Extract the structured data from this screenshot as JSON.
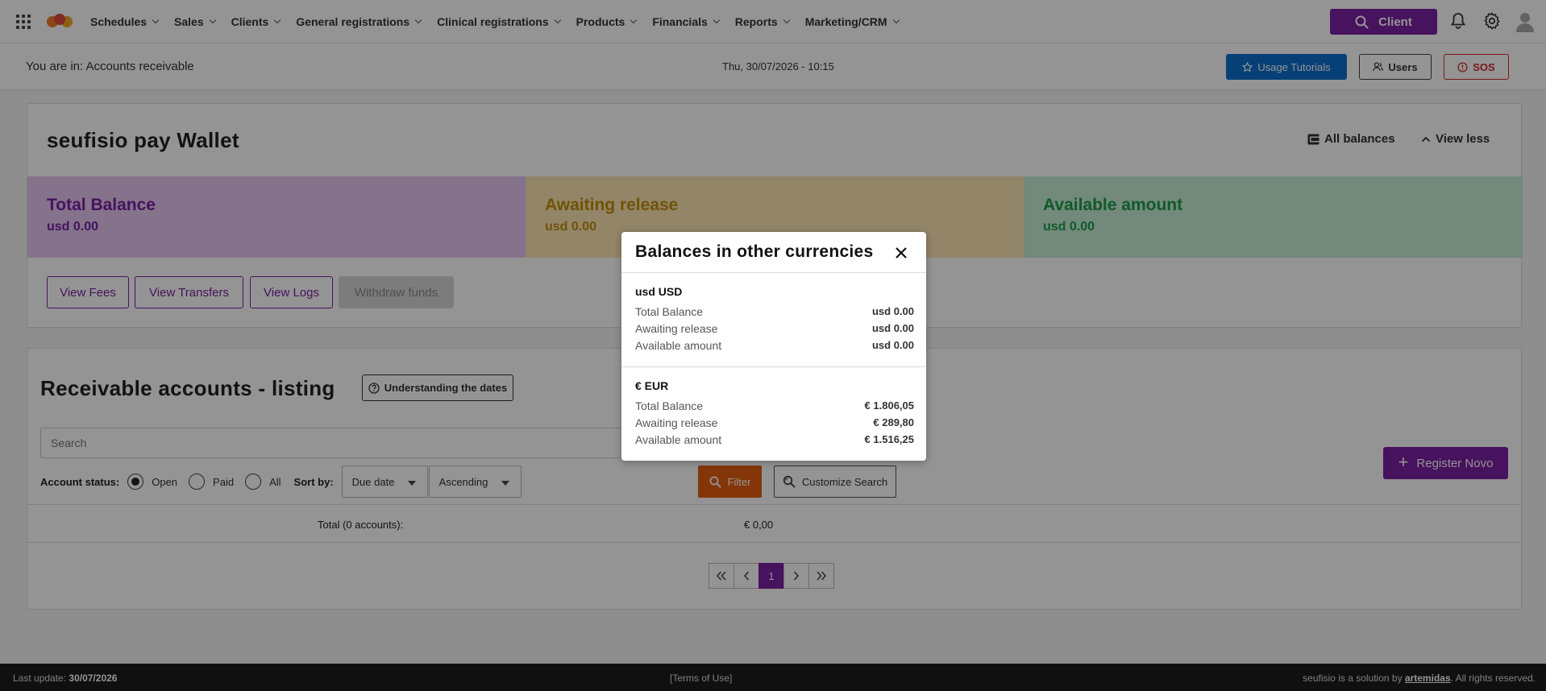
{
  "nav": {
    "items": [
      {
        "label": "Schedules"
      },
      {
        "label": "Sales"
      },
      {
        "label": "Clients"
      },
      {
        "label": "General registrations"
      },
      {
        "label": "Clinical registrations"
      },
      {
        "label": "Products"
      },
      {
        "label": "Financials"
      },
      {
        "label": "Reports"
      },
      {
        "label": "Marketing/CRM"
      }
    ],
    "client_button": "Client"
  },
  "subbar": {
    "breadcrumb": "You are in: Accounts receivable",
    "datetime": "Thu, 30/07/2026 - 10:15",
    "tutorials_button": "Usage Tutorials",
    "users_button": "Users",
    "sos_button": "SOS"
  },
  "wallet": {
    "title": "seufisio pay Wallet",
    "all_balances": "All balances",
    "view_less": "View less",
    "total": {
      "label": "Total Balance",
      "value": "usd 0.00"
    },
    "awaiting": {
      "label": "Awaiting release",
      "value": "usd 0.00"
    },
    "available": {
      "label": "Available amount",
      "value": "usd 0.00"
    },
    "buttons": {
      "fees": "View Fees",
      "transfers": "View Transfers",
      "logs": "View Logs",
      "withdraw": "Withdraw funds"
    }
  },
  "listing": {
    "title": "Receivable accounts - listing",
    "understanding_button": "Understanding the dates",
    "search_placeholder": "Search",
    "register_button": "Register Novo",
    "account_status_label": "Account status:",
    "status_options": [
      {
        "label": "Open",
        "selected": true
      },
      {
        "label": "Paid",
        "selected": false
      },
      {
        "label": "All",
        "selected": false
      }
    ],
    "sort_label": "Sort by:",
    "sort_field": "Due date",
    "sort_order": "Ascending",
    "filter_button": "Filter",
    "customize_button": "Customize Search",
    "total_label": "Total (0 accounts):",
    "total_value": "€ 0,00",
    "current_page": "1"
  },
  "footer": {
    "last_update_label": "Last update:",
    "last_update_date": "30/07/2026",
    "terms": "[Terms of Use]",
    "credit_prefix": "seufisio is a solution by",
    "credit_brand": "artemidas",
    "credit_suffix": ". All rights reserved."
  },
  "modal": {
    "title": "Balances in other currencies",
    "currencies": [
      {
        "name": "usd USD",
        "rows": [
          {
            "label": "Total Balance",
            "value": "usd 0.00"
          },
          {
            "label": "Awaiting release",
            "value": "usd 0.00"
          },
          {
            "label": "Available amount",
            "value": "usd 0.00"
          }
        ]
      },
      {
        "name": "€ EUR",
        "rows": [
          {
            "label": "Total Balance",
            "value": "€ 1.806,05"
          },
          {
            "label": "Awaiting release",
            "value": "€ 289,80"
          },
          {
            "label": "Available amount",
            "value": "€ 1.516,25"
          }
        ]
      }
    ]
  },
  "colors": {
    "brand_purple": "#7a1fa2",
    "primary_blue": "#0d6ecd",
    "danger_red": "#d42a2a",
    "filter_orange": "#e35d0f",
    "total_bg": "#e3c6f0",
    "awaiting_bg": "#fbe5b3",
    "available_bg": "#c4ecd6"
  }
}
